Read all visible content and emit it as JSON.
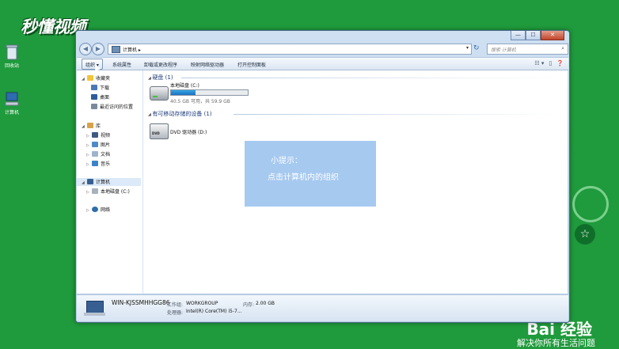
{
  "watermark": "秒懂视频",
  "desktop": {
    "icons": [
      {
        "label": "回收站",
        "icon": "recycle-bin-icon"
      },
      {
        "label": "计算机",
        "icon": "computer-icon"
      }
    ],
    "brand": "Bai 经验",
    "slogan": "解决你所有生活问题"
  },
  "window": {
    "title_buttons": {
      "minimize": "—",
      "maximize": "☐",
      "close": "✕"
    },
    "address": "计算机 ▸",
    "search_placeholder": "搜索 计算机",
    "toolbar": {
      "organize": "组织 ▾",
      "system_properties": "系统属性",
      "uninstall": "卸载或更改程序",
      "map_drive": "映射网络驱动器",
      "control_panel": "打开控制面板"
    },
    "nav": {
      "favorites": "收藏夹",
      "downloads": "下载",
      "desktop": "桌面",
      "recent": "最近访问的位置",
      "libraries": "库",
      "videos": "视频",
      "pictures": "图片",
      "documents": "文档",
      "music": "音乐",
      "computer": "计算机",
      "local_disk": "本地磁盘 (C:)",
      "network": "网络"
    },
    "groups": {
      "hard_drives": "硬盘 (1)",
      "removable": "有可移动存储的设备 (1)"
    },
    "drive_c": {
      "name": "本地磁盘 (C:)",
      "free_text": "40.5 GB 可用，共 59.9 GB",
      "used_fraction": 0.32
    },
    "dvd": {
      "name": "DVD 驱动器 (D:)",
      "logo": "DVD"
    },
    "tip": {
      "line1": "小提示：",
      "line2": "点击计算机内的组织"
    },
    "details": {
      "pc_name": "WIN-KJSSMHHGG86",
      "workgroup_label": "工作组:",
      "workgroup": "WORKGROUP",
      "memory_label": "内存:",
      "memory": "2.00 GB",
      "cpu_label": "处理器:",
      "cpu": "Intel(R) Core(TM) i5-7..."
    }
  }
}
